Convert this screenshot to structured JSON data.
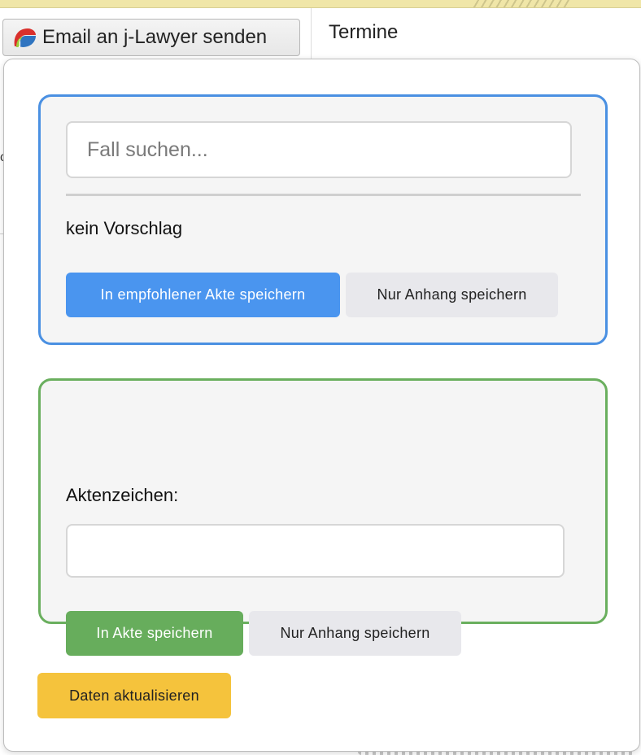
{
  "toolbar": {
    "send_button_label": "Email an j-Lawyer senden",
    "app_icon": "j-lawyer-logo-icon",
    "termine_label": "Termine"
  },
  "background": {
    "edge_glyph": "c"
  },
  "suggest_panel": {
    "search_placeholder": "Fall suchen...",
    "search_value": "",
    "suggestion_text": "kein Vorschlag",
    "save_recommended_label": "In empfohlener Akte speichern",
    "attachment_only_label": "Nur Anhang speichern",
    "border_color": "#4a90e2"
  },
  "manual_panel": {
    "field_label": "Aktenzeichen:",
    "field_value": "",
    "save_label": "In Akte speichern",
    "attachment_only_label": "Nur Anhang speichern",
    "border_color": "#6aaf5e"
  },
  "footer": {
    "refresh_label": "Daten aktualisieren"
  },
  "colors": {
    "primary_blue": "#4a95ef",
    "primary_green": "#67ad5c",
    "refresh_yellow": "#f5c33c"
  }
}
